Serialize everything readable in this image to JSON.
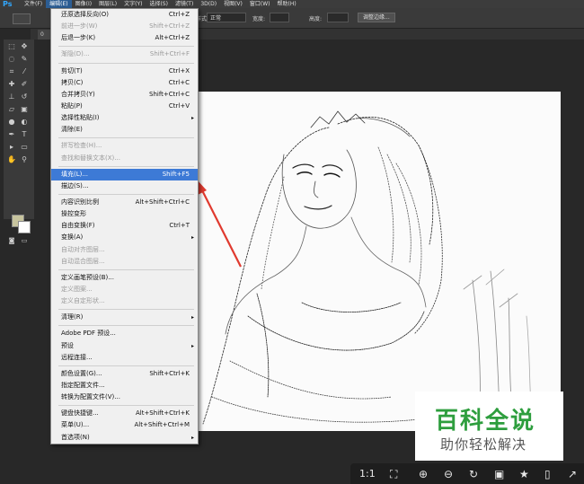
{
  "app": {
    "logo": "Ps"
  },
  "menubar": {
    "items": [
      "文件(F)",
      "编辑(E)",
      "图像(I)",
      "图层(L)",
      "文字(Y)",
      "选择(S)",
      "滤镜(T)",
      "3D(D)",
      "视图(V)",
      "窗口(W)",
      "帮助(H)"
    ],
    "active_index": 1
  },
  "options": {
    "style_label": "样式:",
    "style_value": "正常",
    "width_label": "宽度:",
    "height_label": "高度:",
    "refine_button": "调整边缘..."
  },
  "doc_tab": {
    "label": "0"
  },
  "edit_menu": {
    "items": [
      {
        "label": "还原选择反向(O)",
        "shortcut": "Ctrl+Z"
      },
      {
        "label": "前进一步(W)",
        "shortcut": "Shift+Ctrl+Z",
        "disabled": true
      },
      {
        "label": "后退一步(K)",
        "shortcut": "Alt+Ctrl+Z"
      },
      {
        "sep": true
      },
      {
        "label": "渐隐(D)...",
        "shortcut": "Shift+Ctrl+F",
        "disabled": true
      },
      {
        "sep": true
      },
      {
        "label": "剪切(T)",
        "shortcut": "Ctrl+X"
      },
      {
        "label": "拷贝(C)",
        "shortcut": "Ctrl+C"
      },
      {
        "label": "合并拷贝(Y)",
        "shortcut": "Shift+Ctrl+C"
      },
      {
        "label": "粘贴(P)",
        "shortcut": "Ctrl+V"
      },
      {
        "label": "选择性粘贴(I)",
        "submenu": true
      },
      {
        "label": "清除(E)"
      },
      {
        "sep": true
      },
      {
        "label": "拼写检查(H)...",
        "disabled": true
      },
      {
        "label": "查找和替换文本(X)...",
        "disabled": true
      },
      {
        "sep": true
      },
      {
        "label": "填充(L)...",
        "shortcut": "Shift+F5",
        "highlighted": true
      },
      {
        "label": "描边(S)..."
      },
      {
        "sep": true
      },
      {
        "label": "内容识别比例",
        "shortcut": "Alt+Shift+Ctrl+C"
      },
      {
        "label": "操控变形"
      },
      {
        "label": "自由变换(F)",
        "shortcut": "Ctrl+T"
      },
      {
        "label": "变换(A)",
        "submenu": true
      },
      {
        "label": "自动对齐图层...",
        "disabled": true
      },
      {
        "label": "自动混合图层...",
        "disabled": true
      },
      {
        "sep": true
      },
      {
        "label": "定义画笔预设(B)..."
      },
      {
        "label": "定义图案...",
        "disabled": true
      },
      {
        "label": "定义自定形状...",
        "disabled": true
      },
      {
        "sep": true
      },
      {
        "label": "清理(R)",
        "submenu": true
      },
      {
        "sep": true
      },
      {
        "label": "Adobe PDF 预设..."
      },
      {
        "label": "预设",
        "submenu": true
      },
      {
        "label": "远程连接..."
      },
      {
        "sep": true
      },
      {
        "label": "颜色设置(G)...",
        "shortcut": "Shift+Ctrl+K"
      },
      {
        "label": "指定配置文件..."
      },
      {
        "label": "转换为配置文件(V)..."
      },
      {
        "sep": true
      },
      {
        "label": "键盘快捷键...",
        "shortcut": "Alt+Shift+Ctrl+K"
      },
      {
        "label": "菜单(U)...",
        "shortcut": "Alt+Shift+Ctrl+M"
      },
      {
        "label": "首选项(N)",
        "submenu": true
      }
    ]
  },
  "colors": {
    "foreground": "#c7c49e",
    "background": "#ffffff",
    "highlight": "#3d7ad6",
    "annotation_arrow": "#e03a2f"
  },
  "watermark": {
    "title": "百科全说",
    "subtitle": "助你轻松解决"
  },
  "bottom_bar": {
    "zoom_label": "1:1"
  }
}
